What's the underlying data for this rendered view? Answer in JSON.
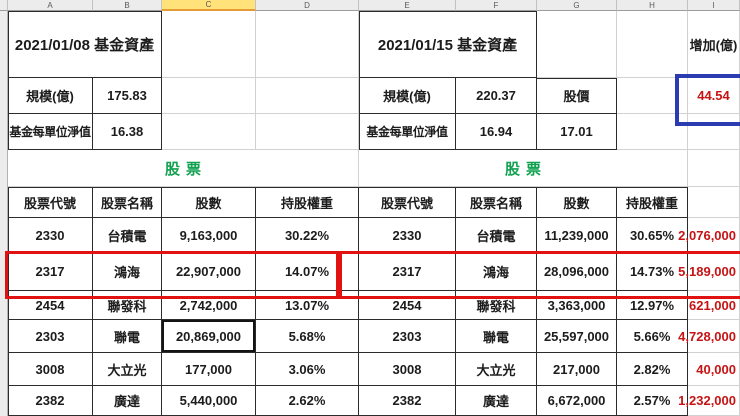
{
  "columns": [
    "A",
    "B",
    "C",
    "D",
    "E",
    "F",
    "G",
    "H",
    "I"
  ],
  "left_summary": {
    "title": "2021/01/08 基金資產",
    "scale_label": "規模(億)",
    "scale_value": "175.83",
    "nav_label": "基金每單位淨值",
    "nav_value": "16.38"
  },
  "right_summary": {
    "title": "2021/01/15 基金資產",
    "scale_label": "規模(億)",
    "scale_value": "220.37",
    "price_label": "股價",
    "nav_label": "基金每單位淨值",
    "nav_value": "16.94",
    "price_value": "17.01"
  },
  "increase": {
    "header": "增加(億)",
    "value": "44.54"
  },
  "stocks_section": {
    "label_left": "股票",
    "label_right": "股票"
  },
  "table": {
    "headers": [
      "股票代號",
      "股票名稱",
      "股數",
      "持股權重"
    ],
    "rows": [
      {
        "code": "2330",
        "name": "台積電",
        "shares_old": "9,163,000",
        "weight_old": "30.22%",
        "shares_new": "11,239,000",
        "weight_new": "30.65%",
        "increase": "2,076,000"
      },
      {
        "code": "2317",
        "name": "鴻海",
        "shares_old": "22,907,000",
        "weight_old": "14.07%",
        "shares_new": "28,096,000",
        "weight_new": "14.73%",
        "increase": "5,189,000"
      },
      {
        "code": "2454",
        "name": "聯發科",
        "shares_old": "2,742,000",
        "weight_old": "13.07%",
        "shares_new": "3,363,000",
        "weight_new": "12.97%",
        "increase": "621,000"
      },
      {
        "code": "2303",
        "name": "聯電",
        "shares_old": "20,869,000",
        "weight_old": "5.68%",
        "shares_new": "25,597,000",
        "weight_new": "5.66%",
        "increase": "4,728,000"
      },
      {
        "code": "3008",
        "name": "大立光",
        "shares_old": "177,000",
        "weight_old": "3.06%",
        "shares_new": "217,000",
        "weight_new": "2.82%",
        "increase": "40,000"
      },
      {
        "code": "2382",
        "name": "廣達",
        "shares_old": "5,440,000",
        "weight_old": "2.62%",
        "shares_new": "6,672,000",
        "weight_new": "2.57%",
        "increase": "1,232,000"
      }
    ]
  },
  "colors": {
    "red_text": "#c61414",
    "red_box_border": "#e01212",
    "blue_box_border": "#2b3cb0",
    "green_text": "#12a150",
    "selected_column_fill": "#ffe27a",
    "gridline": "#d2d2d2"
  }
}
